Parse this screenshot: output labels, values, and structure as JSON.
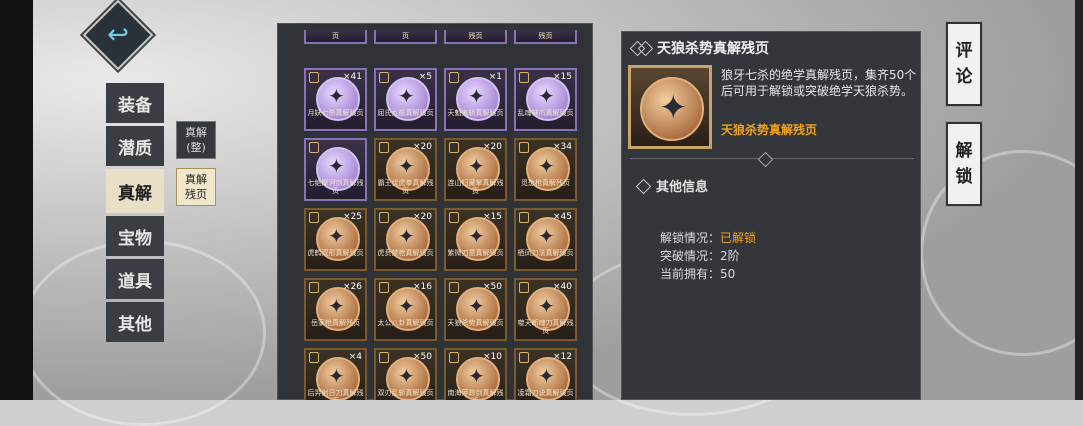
{
  "nav": {
    "items": [
      "装备",
      "潜质",
      "真解",
      "宝物",
      "道具",
      "其他"
    ],
    "active_index": 2,
    "sub_tabs": [
      {
        "label": "真解\n(整)"
      },
      {
        "label": "真解\n残页"
      }
    ]
  },
  "grid": {
    "top_row": [
      "页",
      "页",
      "残页",
      "残页"
    ],
    "rows": [
      [
        {
          "name": "月妖七杀真解残页",
          "count": "×41",
          "purple": true
        },
        {
          "name": "屈氏九般真解残页",
          "count": "×5",
          "purple": true
        },
        {
          "name": "天魁鬼斩真解残页",
          "count": "×1",
          "purple": true
        },
        {
          "name": "乱魂神爪真解残页",
          "count": "×15",
          "purple": true
        }
      ],
      [
        {
          "name": "七绝摩诃剑真解残页",
          "count": "",
          "purple": true
        },
        {
          "name": "霸王伏虎拳真解残页",
          "count": "×20",
          "purple": false
        },
        {
          "name": "连山归藏掌真解残页",
          "count": "×20",
          "purple": false
        },
        {
          "name": "觅愁枪真解残页",
          "count": "×34",
          "purple": false
        }
      ],
      [
        {
          "name": "虎鹤双形真解残页",
          "count": "×25",
          "purple": false
        },
        {
          "name": "虎贲禁枪真解残页",
          "count": "×20",
          "purple": false
        },
        {
          "name": "紫微刀意真解残页",
          "count": "×15",
          "purple": false
        },
        {
          "name": "栖凤刀法真解残页",
          "count": "×45",
          "purple": false
        }
      ],
      [
        {
          "name": "岳家枪真解残页",
          "count": "×26",
          "purple": false
        },
        {
          "name": "太公八卦真解残页",
          "count": "×16",
          "purple": false
        },
        {
          "name": "天狼杀势真解残页",
          "count": "×50",
          "purple": false
        },
        {
          "name": "噬天断魂刀真解残页",
          "count": "×40",
          "purple": false
        }
      ],
      [
        {
          "name": "后羿射日刀真解残页",
          "count": "×4",
          "purple": false
        },
        {
          "name": "双刃乱斩真解残页",
          "count": "×50",
          "purple": false
        },
        {
          "name": "南海萍踪剑真解残页",
          "count": "×10",
          "purple": false
        },
        {
          "name": "凌霜刀诀真解残页",
          "count": "×12",
          "purple": false
        }
      ]
    ]
  },
  "detail": {
    "title": "天狼杀势真解残页",
    "description": "狼牙七杀的绝学真解残页，集齐50个后可用于解锁或突破绝学天狼杀势。",
    "highlight": "天狼杀势真解残页",
    "info_title": "其他信息",
    "info": [
      {
        "label": "解锁情况：",
        "value": "已解锁",
        "gold": true
      },
      {
        "label": "突破情况：",
        "value": "2阶",
        "gold": false
      },
      {
        "label": "当前拥有：",
        "value": "50",
        "gold": false
      }
    ]
  },
  "right_buttons": [
    {
      "label": "评\n论"
    },
    {
      "label": "解\n锁"
    }
  ],
  "colors": {
    "gold": "#f3a21c",
    "purple_frame": "#8a72b8",
    "bronze_frame": "#7b5a2d"
  }
}
